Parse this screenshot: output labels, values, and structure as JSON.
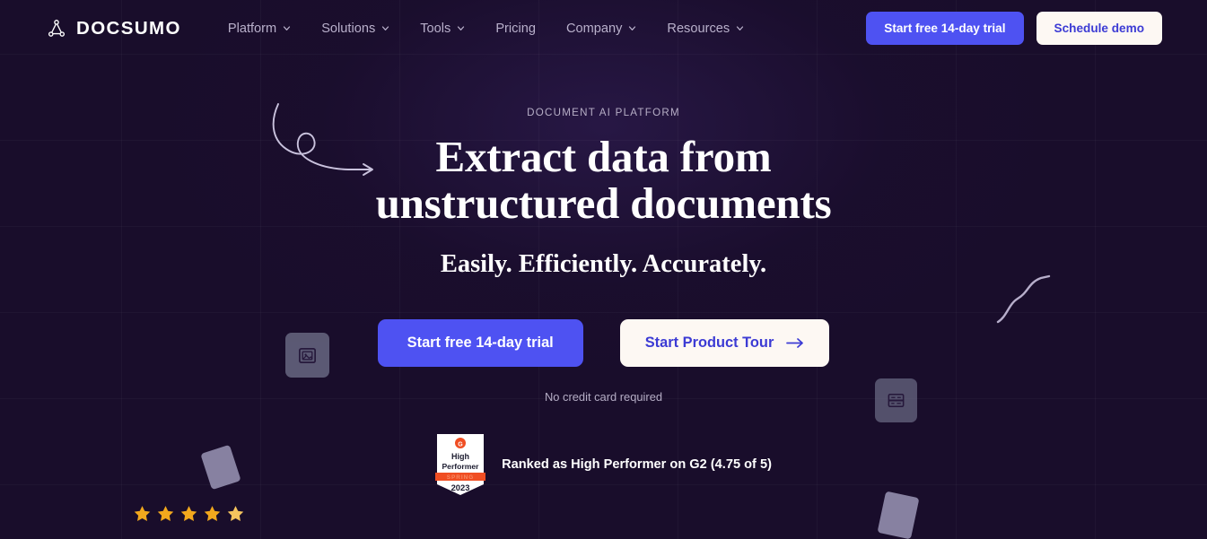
{
  "brand": {
    "name": "DOCSUMO",
    "logo_icon": "node-graph-icon"
  },
  "colors": {
    "background": "#190d2b",
    "accent_blue": "#4e52f2",
    "light_button_bg": "#fdf8f3",
    "light_button_text": "#3c3bd4",
    "nav_text": "#b9b0cb",
    "star_gold": "#f2a81d",
    "tile_grey": "#6a6a84"
  },
  "nav": {
    "items": [
      {
        "label": "Platform",
        "has_dropdown": true,
        "icon": "chevron-down-icon"
      },
      {
        "label": "Solutions",
        "has_dropdown": true,
        "icon": "chevron-down-icon"
      },
      {
        "label": "Tools",
        "has_dropdown": true,
        "icon": "chevron-down-icon"
      },
      {
        "label": "Pricing",
        "has_dropdown": false,
        "icon": ""
      },
      {
        "label": "Company",
        "has_dropdown": true,
        "icon": "chevron-down-icon"
      },
      {
        "label": "Resources",
        "has_dropdown": true,
        "icon": "chevron-down-icon"
      }
    ]
  },
  "header_actions": {
    "trial_label": "Start free 14-day trial",
    "demo_label": "Schedule demo"
  },
  "hero": {
    "eyebrow": "DOCUMENT AI PLATFORM",
    "headline_line1": "Extract data from",
    "headline_line2": "unstructured documents",
    "subheadline": "Easily. Efficiently. Accurately.",
    "primary_cta": "Start free 14-day trial",
    "secondary_cta": "Start Product Tour",
    "secondary_cta_icon": "arrow-right-icon",
    "no_credit_card": "No credit card required"
  },
  "g2": {
    "badge_icon": "g2-high-performer-badge",
    "badge_top_label": "High",
    "badge_top_label2": "Performer",
    "badge_ribbon": "SPRING",
    "badge_year": "2023",
    "ranking_text": "Ranked as High Performer on G2 (4.75 of 5)",
    "rating_value": "4.75",
    "rating_max": "5",
    "stars": [
      "full",
      "full",
      "full",
      "full",
      "partial"
    ]
  },
  "decorations": {
    "tile_a_icon": "image-document-icon",
    "tile_b_icon": "table-data-icon",
    "card_a": "tilted-document-card",
    "card_b": "tilted-document-card",
    "squiggle_left": "curved-arrow-loop",
    "squiggle_right": "s-curve-line"
  }
}
